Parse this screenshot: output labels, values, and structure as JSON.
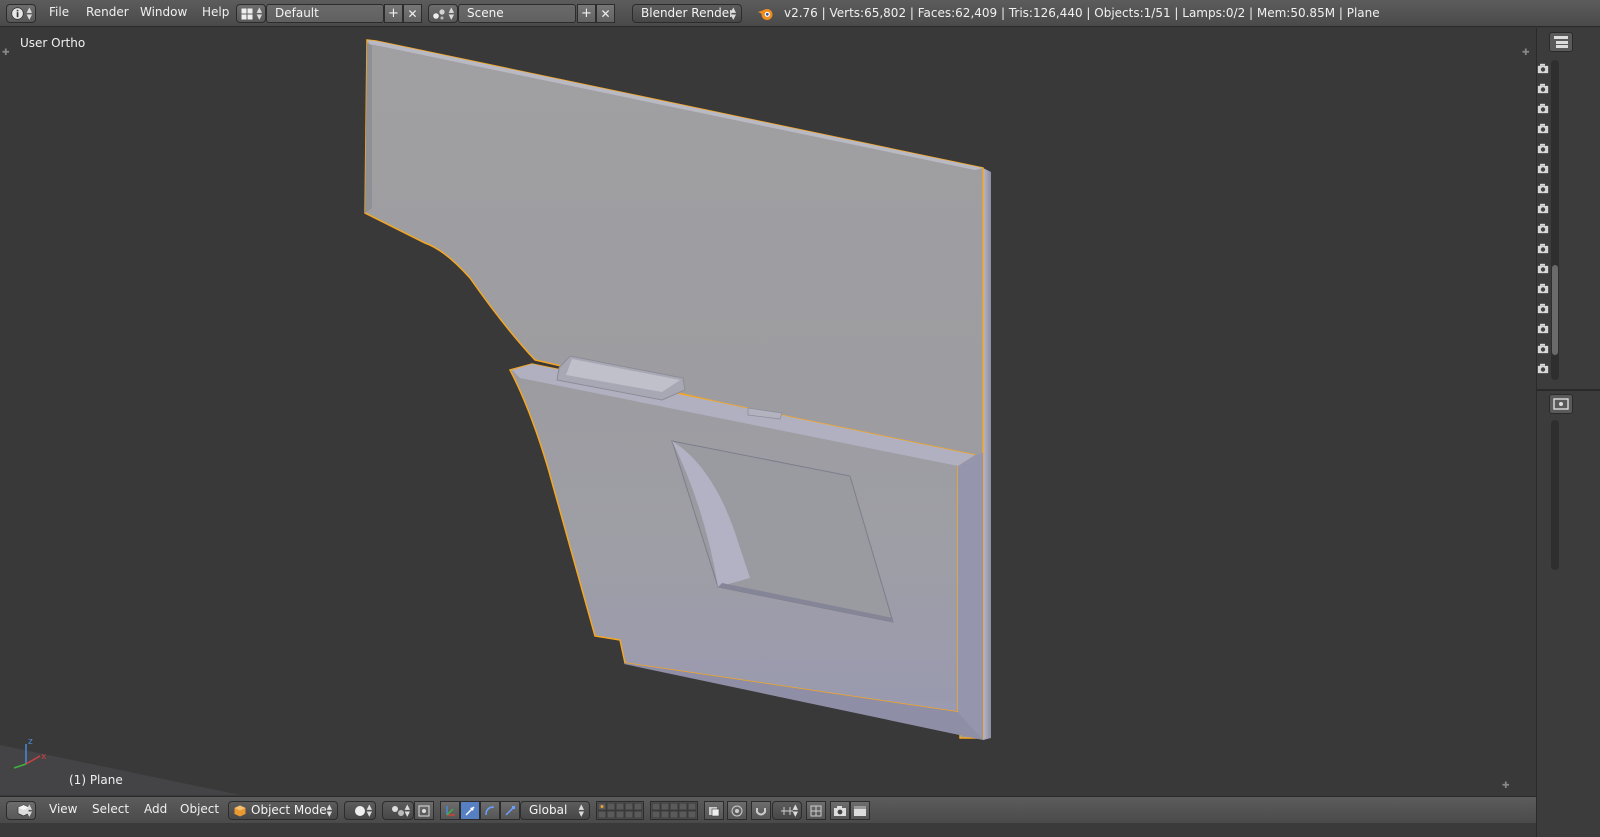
{
  "header": {
    "menus": [
      "File",
      "Render",
      "Window",
      "Help"
    ],
    "layout": "Default",
    "scene": "Scene",
    "render_engine": "Blender Render",
    "stats": "v2.76 | Verts:65,802 | Faces:62,409 | Tris:126,440 | Objects:1/51 | Lamps:0/2 | Mem:50.85M | Plane"
  },
  "viewport": {
    "view_label": "User Ortho",
    "object_label": "(1) Plane",
    "axes": {
      "z": "z",
      "x": "x"
    }
  },
  "bottom": {
    "menus": [
      "View",
      "Select",
      "Add",
      "Object"
    ],
    "mode": "Object Mode",
    "orientation": "Global"
  },
  "colors": {
    "header_bg": "#4f4f4f",
    "viewport_bg": "#393939",
    "selection_outline": "#f5a623",
    "mesh": "#a2a2ab"
  }
}
